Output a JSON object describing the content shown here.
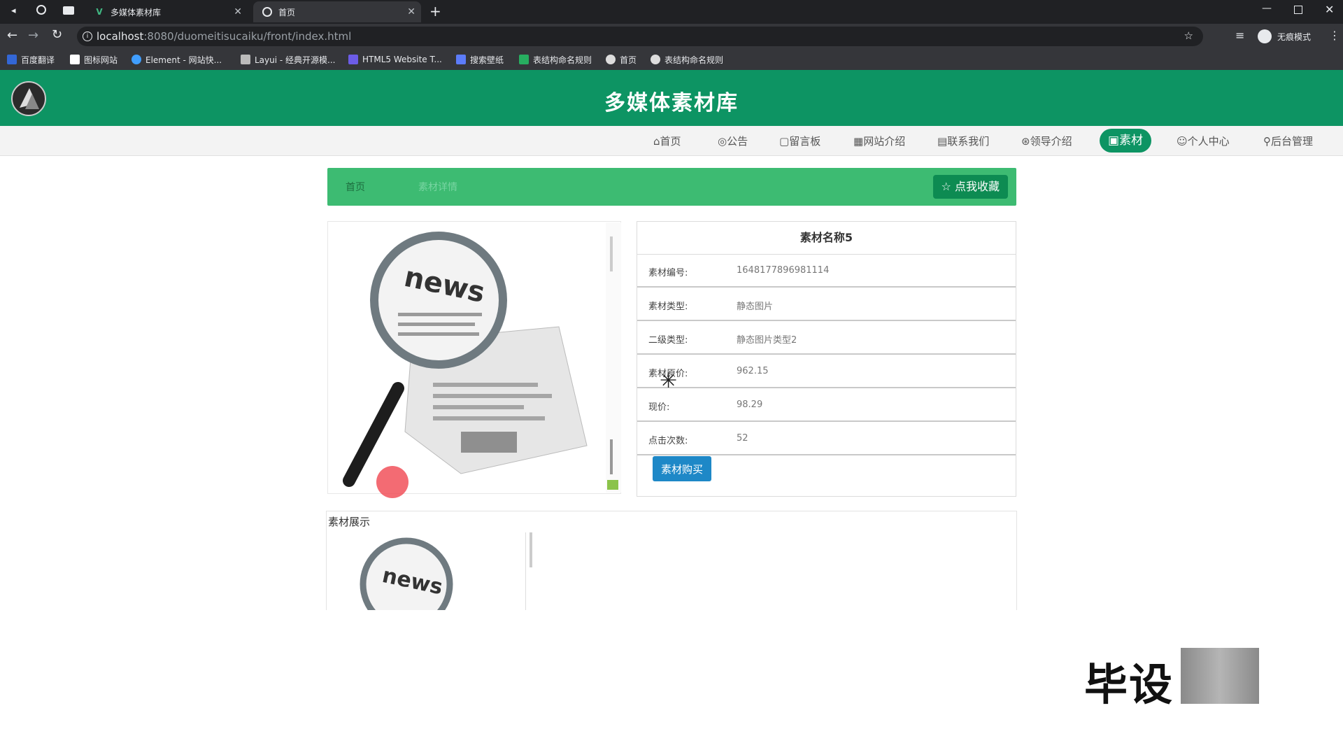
{
  "browser": {
    "tabs": [
      {
        "title": "多媒体素材库",
        "active": false
      },
      {
        "title": "首页",
        "active": true
      }
    ],
    "url_host": "localhost",
    "url_path": ":8080/duomeitisucaiku/front/index.html",
    "profile_label": "无痕模式",
    "bookmarks": [
      {
        "label": "百度翻译",
        "color": "#3367d6"
      },
      {
        "label": "图标网站",
        "color": "#ffffff"
      },
      {
        "label": "Element - 网站快...",
        "color": "#409eff"
      },
      {
        "label": "Layui - 经典开源模...",
        "color": "#bbbbbb"
      },
      {
        "label": "HTML5 Website T...",
        "color": "#6c5ce7"
      },
      {
        "label": "搜索壁纸",
        "color": "#5c7cfa"
      },
      {
        "label": "表结构命名规则",
        "color": "#27ae60"
      },
      {
        "label": "首页",
        "color": "#dddddd"
      },
      {
        "label": "表结构命名规则",
        "color": "#dddddd"
      }
    ]
  },
  "site": {
    "title": "多媒体素材库",
    "nav": [
      {
        "label": "首页",
        "icon": "home-icon",
        "active": false
      },
      {
        "label": "公告",
        "icon": "bell-icon",
        "active": false
      },
      {
        "label": "留言板",
        "icon": "message-icon",
        "active": false
      },
      {
        "label": "网站介绍",
        "icon": "grid-icon",
        "active": false
      },
      {
        "label": "联系我们",
        "icon": "contact-icon",
        "active": false
      },
      {
        "label": "领导介绍",
        "icon": "leader-icon",
        "active": false
      },
      {
        "label": "素材",
        "icon": "material-icon",
        "active": true
      },
      {
        "label": "个人中心",
        "icon": "user-icon",
        "active": false
      },
      {
        "label": "后台管理",
        "icon": "link-icon",
        "active": false
      }
    ]
  },
  "breadcrumb": {
    "home": "首页",
    "current": "素材详情"
  },
  "favorite_label": "点我收藏",
  "detail": {
    "name": "素材名称5",
    "rows": [
      {
        "key": "素材编号:",
        "value": "1648177896981114"
      },
      {
        "key": "素材类型:",
        "value": "静态图片"
      },
      {
        "key": "二级类型:",
        "value": "静态图片类型2"
      },
      {
        "key": "素材原价:",
        "value": "962.15"
      },
      {
        "key": "现价:",
        "value": "98.29"
      },
      {
        "key": "点击次数:",
        "value": "52"
      }
    ],
    "buy_label": "素材购买"
  },
  "showcase": {
    "label": "素材展示"
  },
  "image_text": "news",
  "watermark": "毕设",
  "colors": {
    "header": "#0d9463",
    "breadcrumb": "#3dbb72",
    "buy": "#1e88c7"
  }
}
